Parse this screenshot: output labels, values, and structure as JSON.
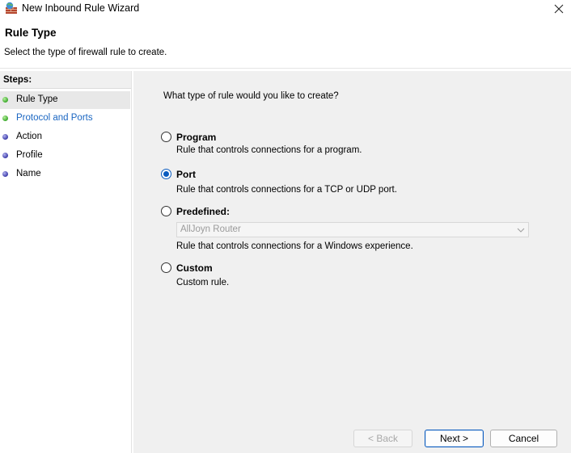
{
  "window": {
    "title": "New Inbound Rule Wizard",
    "icon": "firewall-icon"
  },
  "header": {
    "title": "Rule Type",
    "subtitle": "Select the type of firewall rule to create."
  },
  "steps": {
    "heading": "Steps:",
    "items": [
      {
        "label": "Rule Type",
        "status": "current",
        "dot_color": "#3aa82a"
      },
      {
        "label": "Protocol and Ports",
        "status": "link",
        "dot_color": "#3aa82a"
      },
      {
        "label": "Action",
        "status": "pending",
        "dot_color": "#3b3ba8"
      },
      {
        "label": "Profile",
        "status": "pending",
        "dot_color": "#3b3ba8"
      },
      {
        "label": "Name",
        "status": "pending",
        "dot_color": "#3b3ba8"
      }
    ]
  },
  "main": {
    "question": "What type of rule would you like to create?",
    "options": [
      {
        "label": "Program",
        "description": "Rule that controls connections for a program.",
        "selected": false
      },
      {
        "label": "Port",
        "description": "Rule that controls connections for a TCP or UDP port.",
        "selected": true
      },
      {
        "label": "Predefined:",
        "description": "Rule that controls connections for a Windows experience.",
        "selected": false
      },
      {
        "label": "Custom",
        "description": "Custom rule.",
        "selected": false
      }
    ],
    "predefined_dropdown": {
      "value": "AllJoyn Router",
      "enabled": false
    }
  },
  "buttons": {
    "back": "< Back",
    "next": "Next >",
    "cancel": "Cancel"
  },
  "colors": {
    "accent": "#0a5bbf",
    "link": "#1a66c2",
    "panel_bg": "#f0f0f0"
  }
}
